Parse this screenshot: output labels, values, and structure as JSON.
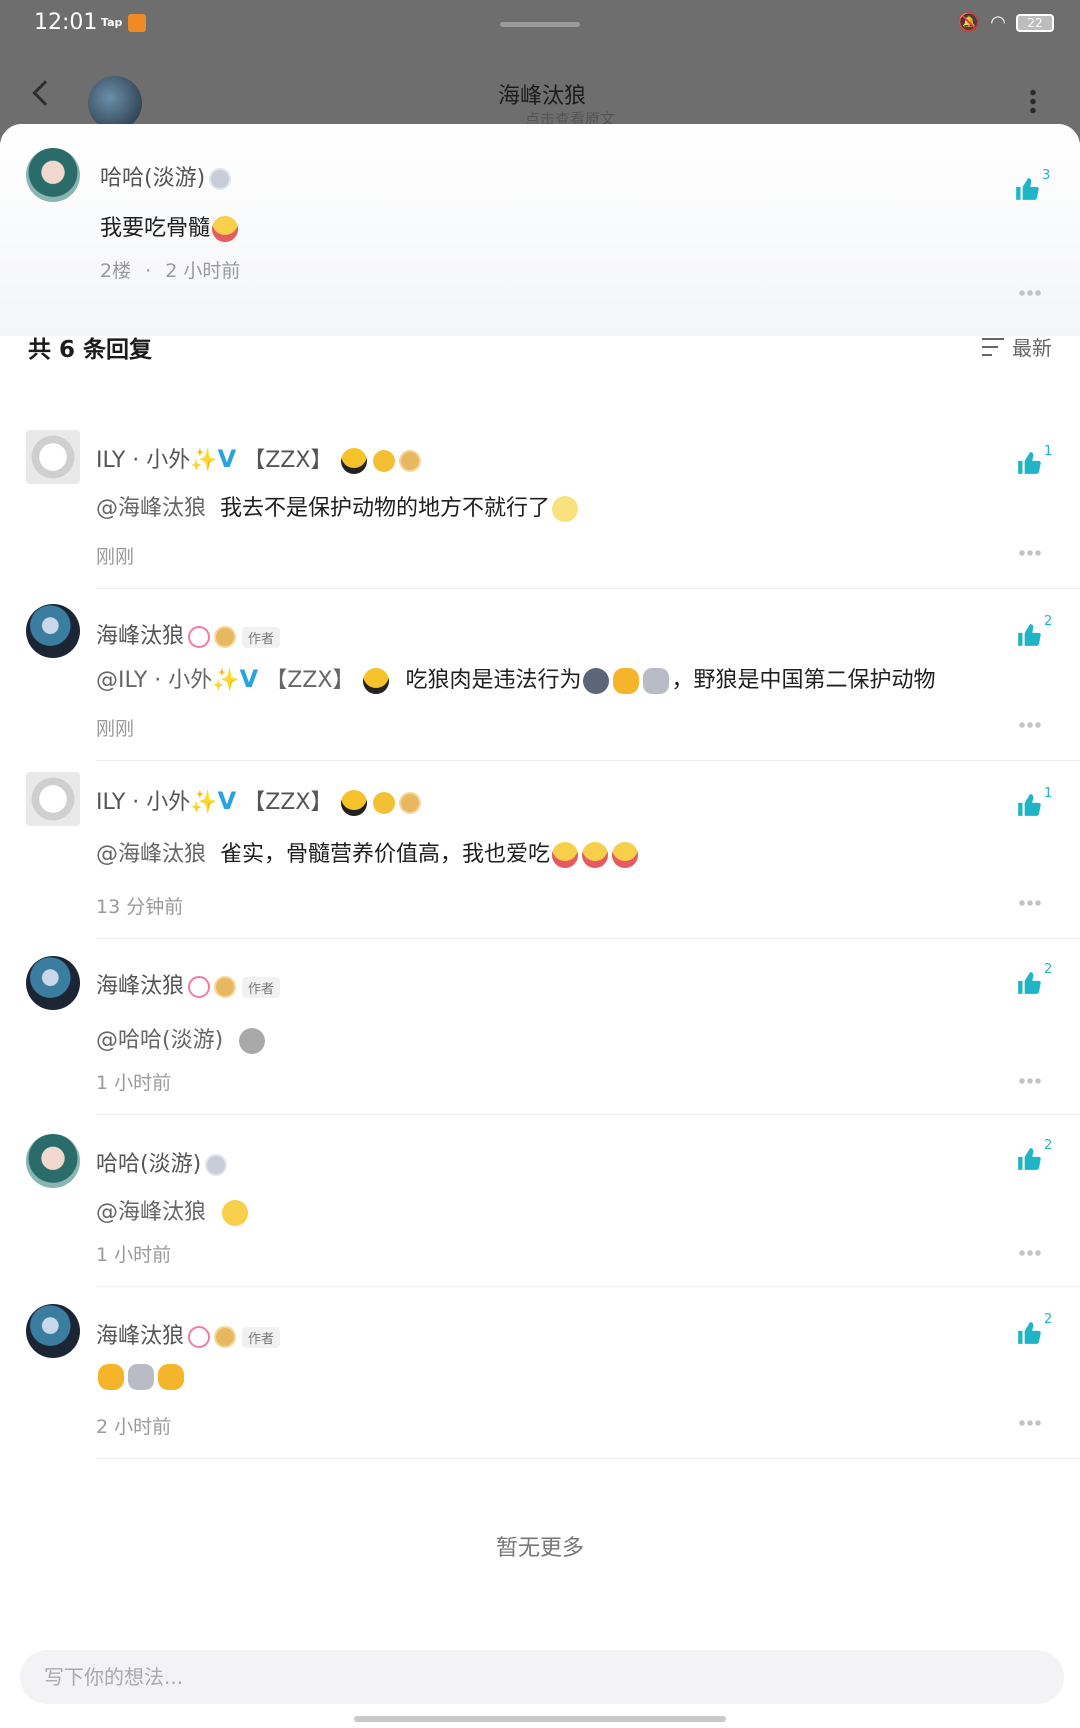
{
  "status_bar": {
    "time": "12:01",
    "tap_label": "Tap",
    "battery": "22",
    "icons": [
      "mute-icon",
      "wifi-icon",
      "battery-icon"
    ]
  },
  "header": {
    "title": "海峰汰狼",
    "subtitle": "点击查看原文"
  },
  "parent_comment": {
    "author": "哈哈(淡游)",
    "text": "我要吃骨髓",
    "floor": "2楼",
    "separator": "·",
    "time": "2 小时前",
    "likes": "3"
  },
  "replies_header": {
    "title": "共 6 条回复",
    "sort_label": "最新"
  },
  "replies": [
    {
      "author_prefix": "ILY · 小外",
      "author_suffix": "【ZZX】",
      "mention": "@海峰汰狼",
      "text": "我去不是保护动物的地方不就行了",
      "time": "刚刚",
      "likes": "1"
    },
    {
      "author": "海峰汰狼",
      "author_tag": "作者",
      "mention_prefix": "@ILY · 小外",
      "mention_suffix": "【ZZX】",
      "text_a": "吃狼肉是违法行为",
      "text_b": "，野狼是中国第二保护动物",
      "time": "刚刚",
      "likes": "2"
    },
    {
      "author_prefix": "ILY · 小外",
      "author_suffix": "【ZZX】",
      "mention": "@海峰汰狼",
      "text": "雀实，骨髓营养价值高，我也爱吃",
      "time": "13 分钟前",
      "likes": "1"
    },
    {
      "author": "海峰汰狼",
      "author_tag": "作者",
      "mention": "@哈哈(淡游)",
      "time": "1 小时前",
      "likes": "2"
    },
    {
      "author": "哈哈(淡游)",
      "mention": "@海峰汰狼",
      "time": "1 小时前",
      "likes": "2"
    },
    {
      "author": "海峰汰狼",
      "author_tag": "作者",
      "time": "2 小时前",
      "likes": "2"
    }
  ],
  "no_more": "暂无更多",
  "input": {
    "placeholder": "写下你的想法..."
  },
  "colors": {
    "accent": "#1fb4c6",
    "verify": "#29a3e0"
  }
}
